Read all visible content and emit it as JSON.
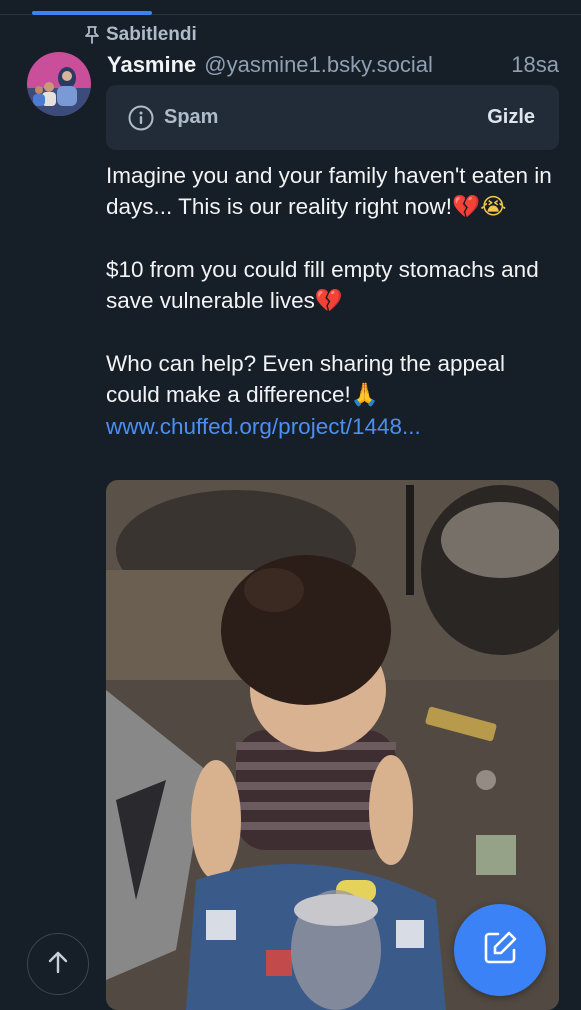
{
  "pinned": {
    "label": "Sabitlendi",
    "icon": "pin-icon"
  },
  "post": {
    "author_name": "Yasmine",
    "author_handle": "@yasmine1.bsky.social",
    "time": "18sa",
    "moderation": {
      "icon": "info-icon",
      "label": "Spam",
      "action": "Gizle"
    },
    "text": {
      "p1": " Imagine you and your family haven't eaten in days... This is our reality right now!",
      "p1_emoji_1": "💔",
      "p1_emoji_2": "😭",
      "p2": "$10 from you could fill empty stomachs and save vulnerable lives",
      "p2_emoji": "💔",
      "p3": "Who can help? Even sharing the appeal could make a difference!",
      "p3_emoji": "🙏",
      "link": "www.chuffed.org/project/1448..."
    }
  },
  "colors": {
    "accent": "#3b82f6",
    "link": "#4b8ff3",
    "background": "#161e27",
    "card": "#222c38"
  },
  "fab": {
    "scroll_top_icon": "arrow-up-icon",
    "compose_icon": "compose-icon"
  }
}
